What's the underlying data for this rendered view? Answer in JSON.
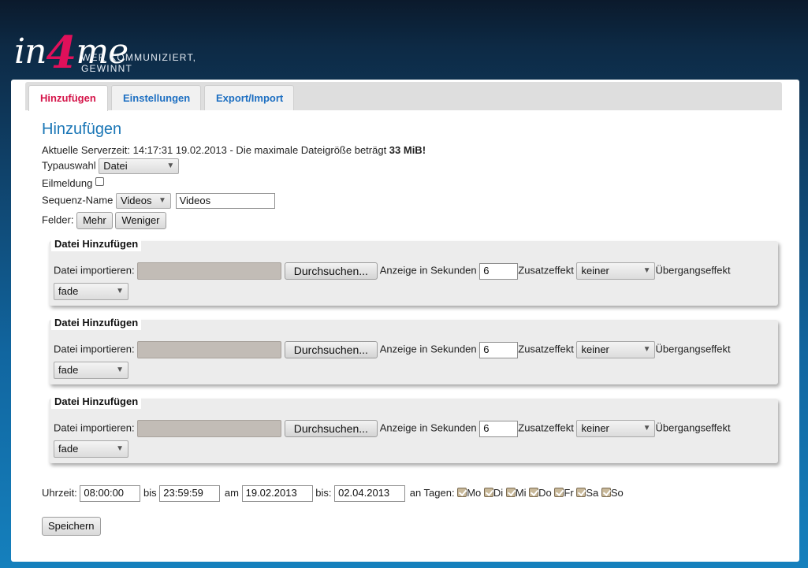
{
  "header": {
    "logo_prefix": "in",
    "logo_number": "4",
    "logo_suffix": "me",
    "tagline": "WER KOMMUNIZIERT, GEWINNT"
  },
  "tabs": [
    {
      "label": "Hinzufügen",
      "active": true
    },
    {
      "label": "Einstellungen",
      "active": false
    },
    {
      "label": "Export/Import",
      "active": false
    }
  ],
  "page_title": "Hinzufügen",
  "server_info": {
    "text": "Aktuelle Serverzeit: 14:17:31 19.02.2013 - Die maximale Dateigröße beträgt ",
    "max_size": "33 MiB!"
  },
  "typauswahl": {
    "label": "Typauswahl",
    "value": "Datei"
  },
  "eilmeldung": {
    "label": "Eilmeldung",
    "checked": false
  },
  "sequenz": {
    "label": "Sequenz-Name",
    "select_value": "Videos",
    "input_value": "Videos"
  },
  "felder": {
    "label": "Felder:",
    "more_label": "Mehr",
    "less_label": "Weniger"
  },
  "file_boxes": [
    {
      "legend": "Datei Hinzufügen",
      "import_label": "Datei importieren:",
      "browse_label": "Durchsuchen...",
      "seconds_label": "Anzeige in Sekunden",
      "seconds_value": "6",
      "effect_label": "Zusatzeffekt",
      "effect_value": "keiner",
      "transition_label": "Übergangseffekt",
      "transition_value": "fade"
    },
    {
      "legend": "Datei Hinzufügen",
      "import_label": "Datei importieren:",
      "browse_label": "Durchsuchen...",
      "seconds_label": "Anzeige in Sekunden",
      "seconds_value": "6",
      "effect_label": "Zusatzeffekt",
      "effect_value": "keiner",
      "transition_label": "Übergangseffekt",
      "transition_value": "fade"
    },
    {
      "legend": "Datei Hinzufügen",
      "import_label": "Datei importieren:",
      "browse_label": "Durchsuchen...",
      "seconds_label": "Anzeige in Sekunden",
      "seconds_value": "6",
      "effect_label": "Zusatzeffekt",
      "effect_value": "keiner",
      "transition_label": "Übergangseffekt",
      "transition_value": "fade"
    }
  ],
  "schedule": {
    "time_label": "Uhrzeit:",
    "time_from": "08:00:00",
    "bis1": "bis",
    "time_to": "23:59:59",
    "am_label": "am",
    "date_from": "19.02.2013",
    "bis2": "bis:",
    "date_to": "02.04.2013",
    "days_label": "an Tagen:",
    "days": [
      {
        "label": "Mo",
        "checked": true
      },
      {
        "label": "Di",
        "checked": true
      },
      {
        "label": "Mi",
        "checked": true
      },
      {
        "label": "Do",
        "checked": true
      },
      {
        "label": "Fr",
        "checked": true
      },
      {
        "label": "Sa",
        "checked": true
      },
      {
        "label": "So",
        "checked": true
      }
    ]
  },
  "save_label": "Speichern",
  "colors": {
    "accent_blue": "#1a76b6",
    "tab_active_red": "#d5154a",
    "logo_pink": "#e0105a"
  }
}
